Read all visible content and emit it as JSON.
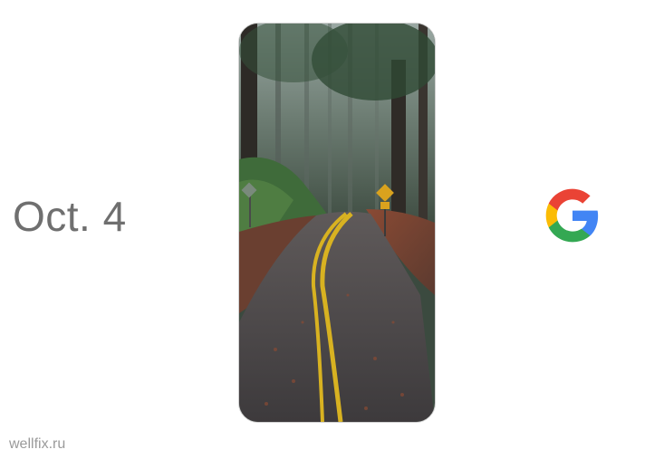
{
  "event_date": "Oct. 4",
  "watermark": "wellfix.ru",
  "phone_wallpaper": "forest-road",
  "logo": "google-g",
  "colors": {
    "google_blue": "#4285F4",
    "google_red": "#EA4335",
    "google_yellow": "#FBBC05",
    "google_green": "#34A853",
    "date_text": "#6f6f6f"
  }
}
